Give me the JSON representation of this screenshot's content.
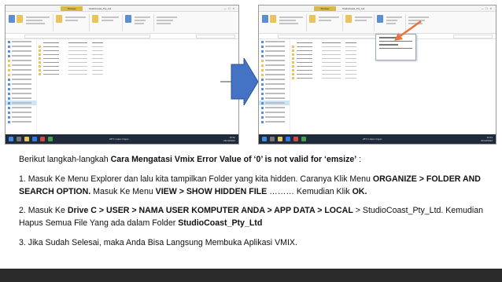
{
  "screenshot_left": {
    "ribbon_tab_label": "Manage",
    "window_title": "StudioCoast_Pty_Ltd",
    "taskbar_weather": "28°C  Hujan ringan",
    "taskbar_time": "10:42",
    "taskbar_date": "24/10/2022"
  },
  "screenshot_right": {
    "ribbon_tab_label": "Manage",
    "window_title": "StudioCoast_Pty_Ltd",
    "taskbar_weather": "28°C  Hujan ringan",
    "taskbar_time": "10:43",
    "taskbar_date": "24/10/2022"
  },
  "colors": {
    "arrow_fill": "#4472c4",
    "highlight_arrow": "#e8743b",
    "footer_bar": "#2b2b2b",
    "taskbar": "#1f2a3a"
  },
  "caption": {
    "intro": {
      "text1": "Berikut langkah-langkah ",
      "bold1": "Cara Mengatasi Vmix Error Value of ‘0’ is not valid for ‘emsize’",
      "text2": " :"
    },
    "step1": {
      "text1": "1. Masuk Ke Menu Explorer dan lalu kita tampilkan Folder yang kita hidden. Caranya Klik Menu ",
      "bold1": "ORGANIZE > FOLDER AND SEARCH OPTION.",
      "text2": " Masuk Ke Menu ",
      "bold2": "VIEW > SHOW HIDDEN FILE",
      "text3": " ……… Kemudian Klik ",
      "bold3": "OK."
    },
    "step2": {
      "text1": "2. Masuk Ke ",
      "bold1": "Drive C > USER > NAMA USER KOMPUTER ANDA > APP DATA > LOCAL",
      "text2": " > StudioCoast_Pty_Ltd.  Kemudian Hapus Semua File Yang ada dalam Folder ",
      "bold2": "StudioCoast_Pty_Ltd"
    },
    "step3": {
      "text1": "3. Jika Sudah Selesai, maka Anda Bisa Langsung Membuka Aplikasi VMIX."
    }
  }
}
